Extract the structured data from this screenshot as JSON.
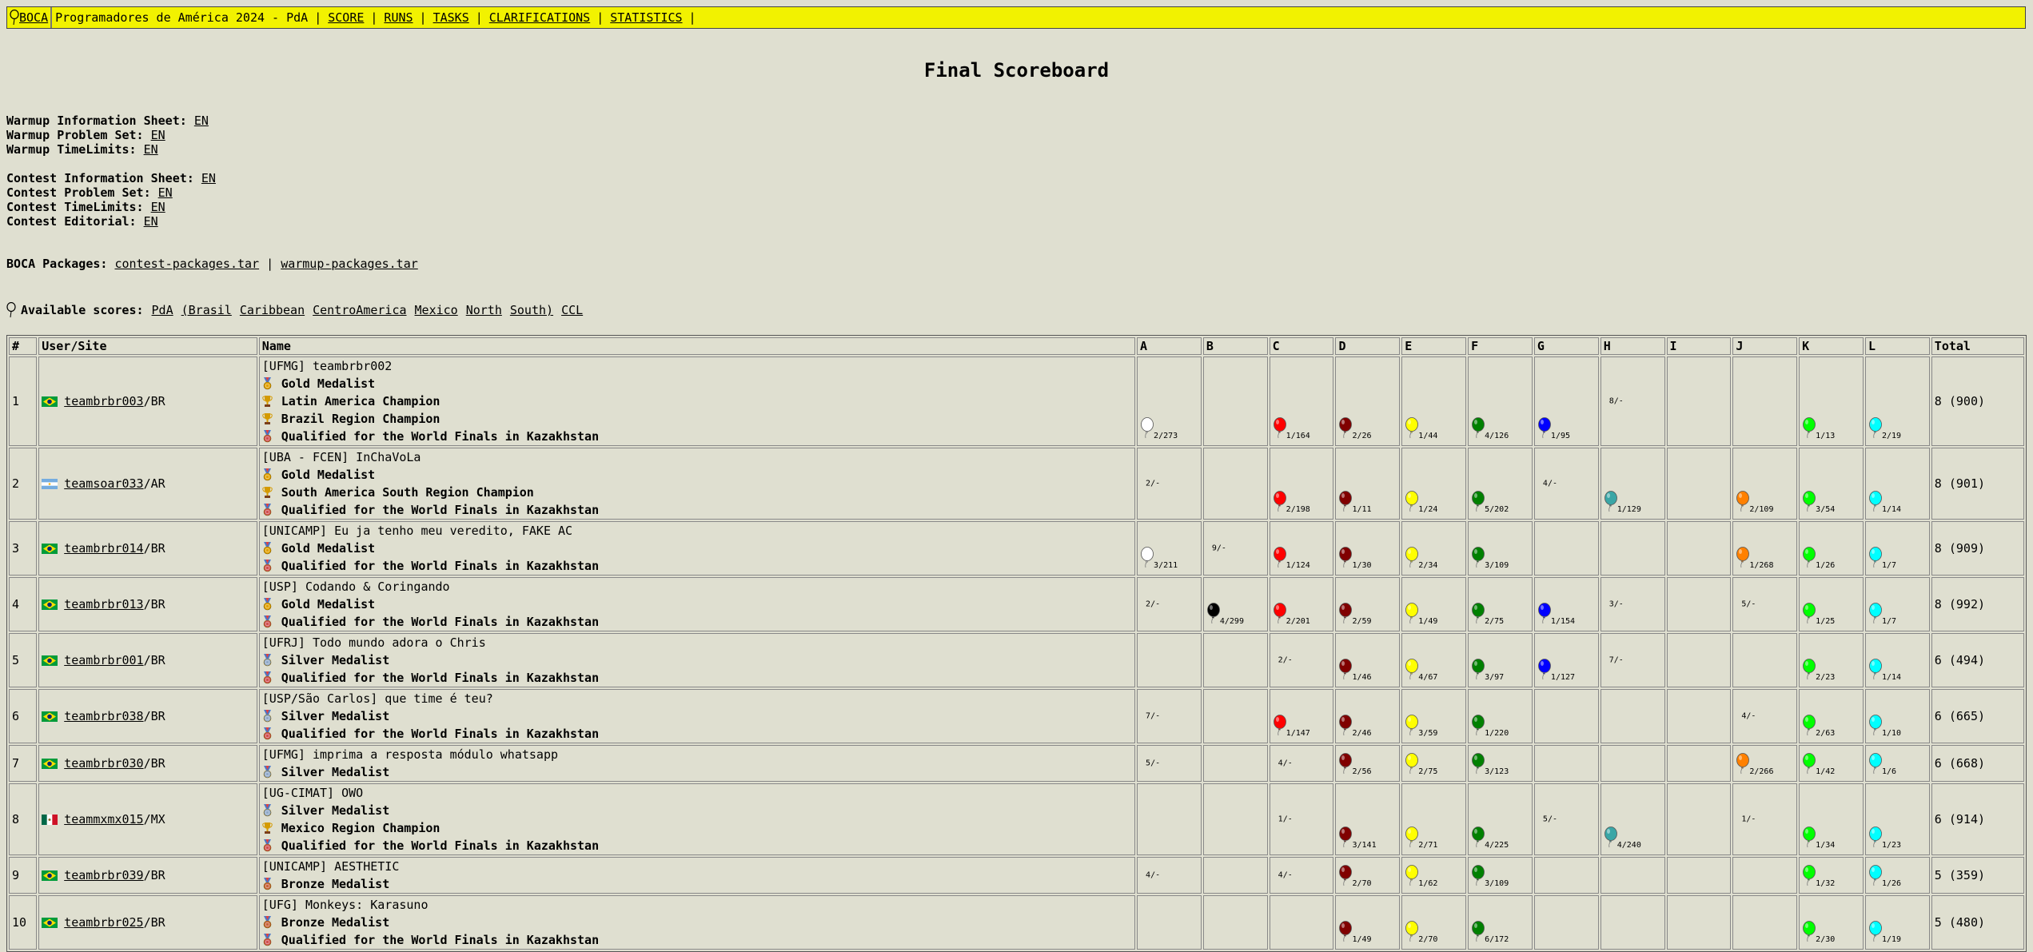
{
  "topbar": {
    "logo_label": "BOCA",
    "contest_title": "Programadores de América 2024 - PdA",
    "menu": [
      {
        "label": "SCORE",
        "name": "menu-score"
      },
      {
        "label": "RUNS",
        "name": "menu-runs"
      },
      {
        "label": "TASKS",
        "name": "menu-tasks"
      },
      {
        "label": "CLARIFICATIONS",
        "name": "menu-clarifications"
      },
      {
        "label": "STATISTICS",
        "name": "menu-statistics"
      }
    ],
    "separator": "|"
  },
  "page_title": "Final Scoreboard",
  "info_lines": [
    {
      "label": "Warmup Information Sheet:",
      "link": "EN"
    },
    {
      "label": "Warmup Problem Set:",
      "link": "EN"
    },
    {
      "label": "Warmup TimeLimits:",
      "link": "EN"
    },
    {
      "label": "Contest Information Sheet:",
      "link": "EN"
    },
    {
      "label": "Contest Problem Set:",
      "link": "EN"
    },
    {
      "label": "Contest TimeLimits:",
      "link": "EN"
    },
    {
      "label": "Contest Editorial:",
      "link": "EN"
    }
  ],
  "packages": {
    "label": "BOCA Packages:",
    "links": [
      "contest-packages.tar",
      "warmup-packages.tar"
    ],
    "separator": "|"
  },
  "scores": {
    "label": "Available scores:",
    "links": [
      "PdA",
      "(Brasil",
      "Caribbean",
      "CentroAmerica",
      "Mexico",
      "North",
      "South)",
      "CCL"
    ]
  },
  "table": {
    "headers": [
      "#",
      "User/Site",
      "Name",
      "A",
      "B",
      "C",
      "D",
      "E",
      "F",
      "G",
      "H",
      "I",
      "J",
      "K",
      "L",
      "Total"
    ],
    "problem_colors": {
      "A": "#ffffff",
      "B": "#000000",
      "C": "#ff0000",
      "D": "#800000",
      "E": "#ffff00",
      "F": "#008000",
      "G": "#0000ff",
      "H": "#3aa6a6",
      "I": "#cccccc",
      "J": "#ff8000",
      "K": "#00ff00",
      "L": "#00ffff"
    },
    "award_colors": {
      "gold": "#e2a100",
      "silver": "#8fa8c8",
      "bronze": "#c8643c",
      "trophy": "#d49a00",
      "finals": "#d05050"
    },
    "rows": [
      {
        "rank": "1",
        "flag": "BR",
        "user": "teambrbr003",
        "site": "/BR",
        "team": "[UFMG] teambrbr002",
        "awards": [
          {
            "type": "gold",
            "text": "Gold Medalist"
          },
          {
            "type": "trophy",
            "text": "Latin America Champion"
          },
          {
            "type": "trophy",
            "text": "Brazil Region Champion"
          },
          {
            "type": "finals",
            "text": "Qualified for the World Finals in Kazakhstan"
          }
        ],
        "cells": {
          "A": {
            "solved": true,
            "text": "2/273"
          },
          "B": null,
          "C": {
            "solved": true,
            "text": "1/164"
          },
          "D": {
            "solved": true,
            "text": "2/26"
          },
          "E": {
            "solved": true,
            "text": "1/44"
          },
          "F": {
            "solved": true,
            "text": "4/126"
          },
          "G": {
            "solved": true,
            "text": "1/95"
          },
          "H": {
            "solved": false,
            "text": "8/-"
          },
          "I": null,
          "J": null,
          "K": {
            "solved": true,
            "text": "1/13"
          },
          "L": {
            "solved": true,
            "text": "2/19"
          }
        },
        "total": "8 (900)"
      },
      {
        "rank": "2",
        "flag": "AR",
        "user": "teamsoar033",
        "site": "/AR",
        "team": "[UBA - FCEN] InChaVoLa",
        "awards": [
          {
            "type": "gold",
            "text": "Gold Medalist"
          },
          {
            "type": "trophy",
            "text": "South America South Region Champion"
          },
          {
            "type": "finals",
            "text": "Qualified for the World Finals in Kazakhstan"
          }
        ],
        "cells": {
          "A": {
            "solved": false,
            "text": "2/-"
          },
          "B": null,
          "C": {
            "solved": true,
            "text": "2/198"
          },
          "D": {
            "solved": true,
            "text": "1/11"
          },
          "E": {
            "solved": true,
            "text": "1/24"
          },
          "F": {
            "solved": true,
            "text": "5/202"
          },
          "G": {
            "solved": false,
            "text": "4/-"
          },
          "H": {
            "solved": true,
            "text": "1/129"
          },
          "I": null,
          "J": {
            "solved": true,
            "text": "2/109"
          },
          "K": {
            "solved": true,
            "text": "3/54"
          },
          "L": {
            "solved": true,
            "text": "1/14"
          }
        },
        "total": "8 (901)"
      },
      {
        "rank": "3",
        "flag": "BR",
        "user": "teambrbr014",
        "site": "/BR",
        "team": "[UNICAMP] Eu ja tenho meu veredito, FAKE AC",
        "awards": [
          {
            "type": "gold",
            "text": "Gold Medalist"
          },
          {
            "type": "finals",
            "text": "Qualified for the World Finals in Kazakhstan"
          }
        ],
        "cells": {
          "A": {
            "solved": true,
            "text": "3/211"
          },
          "B": {
            "solved": false,
            "text": "9/-"
          },
          "C": {
            "solved": true,
            "text": "1/124"
          },
          "D": {
            "solved": true,
            "text": "1/30"
          },
          "E": {
            "solved": true,
            "text": "2/34"
          },
          "F": {
            "solved": true,
            "text": "3/109"
          },
          "G": null,
          "H": null,
          "I": null,
          "J": {
            "solved": true,
            "text": "1/268"
          },
          "K": {
            "solved": true,
            "text": "1/26"
          },
          "L": {
            "solved": true,
            "text": "1/7"
          }
        },
        "total": "8 (909)"
      },
      {
        "rank": "4",
        "flag": "BR",
        "user": "teambrbr013",
        "site": "/BR",
        "team": "[USP] Codando & Coringando",
        "awards": [
          {
            "type": "gold",
            "text": "Gold Medalist"
          },
          {
            "type": "finals",
            "text": "Qualified for the World Finals in Kazakhstan"
          }
        ],
        "cells": {
          "A": {
            "solved": false,
            "text": "2/-"
          },
          "B": {
            "solved": true,
            "text": "4/299"
          },
          "C": {
            "solved": true,
            "text": "2/201"
          },
          "D": {
            "solved": true,
            "text": "2/59"
          },
          "E": {
            "solved": true,
            "text": "1/49"
          },
          "F": {
            "solved": true,
            "text": "2/75"
          },
          "G": {
            "solved": true,
            "text": "1/154"
          },
          "H": {
            "solved": false,
            "text": "3/-"
          },
          "I": null,
          "J": {
            "solved": false,
            "text": "5/-"
          },
          "K": {
            "solved": true,
            "text": "1/25"
          },
          "L": {
            "solved": true,
            "text": "1/7"
          }
        },
        "total": "8 (992)"
      },
      {
        "rank": "5",
        "flag": "BR",
        "user": "teambrbr001",
        "site": "/BR",
        "team": "[UFRJ] Todo mundo adora o Chris",
        "awards": [
          {
            "type": "silver",
            "text": "Silver Medalist"
          },
          {
            "type": "finals",
            "text": "Qualified for the World Finals in Kazakhstan"
          }
        ],
        "cells": {
          "A": null,
          "B": null,
          "C": {
            "solved": false,
            "text": "2/-"
          },
          "D": {
            "solved": true,
            "text": "1/46"
          },
          "E": {
            "solved": true,
            "text": "4/67"
          },
          "F": {
            "solved": true,
            "text": "3/97"
          },
          "G": {
            "solved": true,
            "text": "1/127"
          },
          "H": {
            "solved": false,
            "text": "7/-"
          },
          "I": null,
          "J": null,
          "K": {
            "solved": true,
            "text": "2/23"
          },
          "L": {
            "solved": true,
            "text": "1/14"
          }
        },
        "total": "6 (494)"
      },
      {
        "rank": "6",
        "flag": "BR",
        "user": "teambrbr038",
        "site": "/BR",
        "team": "[USP/São Carlos] que time é teu?",
        "awards": [
          {
            "type": "silver",
            "text": "Silver Medalist"
          },
          {
            "type": "finals",
            "text": "Qualified for the World Finals in Kazakhstan"
          }
        ],
        "cells": {
          "A": {
            "solved": false,
            "text": "7/-"
          },
          "B": null,
          "C": {
            "solved": true,
            "text": "1/147"
          },
          "D": {
            "solved": true,
            "text": "2/46"
          },
          "E": {
            "solved": true,
            "text": "3/59"
          },
          "F": {
            "solved": true,
            "text": "1/220"
          },
          "G": null,
          "H": null,
          "I": null,
          "J": {
            "solved": false,
            "text": "4/-"
          },
          "K": {
            "solved": true,
            "text": "2/63"
          },
          "L": {
            "solved": true,
            "text": "1/10"
          }
        },
        "total": "6 (665)"
      },
      {
        "rank": "7",
        "flag": "BR",
        "user": "teambrbr030",
        "site": "/BR",
        "team": "[UFMG] imprima a resposta módulo whatsapp",
        "awards": [
          {
            "type": "silver",
            "text": "Silver Medalist"
          }
        ],
        "cells": {
          "A": {
            "solved": false,
            "text": "5/-"
          },
          "B": null,
          "C": {
            "solved": false,
            "text": "4/-"
          },
          "D": {
            "solved": true,
            "text": "2/56"
          },
          "E": {
            "solved": true,
            "text": "2/75"
          },
          "F": {
            "solved": true,
            "text": "3/123"
          },
          "G": null,
          "H": null,
          "I": null,
          "J": {
            "solved": true,
            "text": "2/266"
          },
          "K": {
            "solved": true,
            "text": "1/42"
          },
          "L": {
            "solved": true,
            "text": "1/6"
          }
        },
        "total": "6 (668)"
      },
      {
        "rank": "8",
        "flag": "MX",
        "user": "teammxmx015",
        "site": "/MX",
        "team": "[UG-CIMAT] OWO",
        "awards": [
          {
            "type": "silver",
            "text": "Silver Medalist"
          },
          {
            "type": "trophy",
            "text": "Mexico Region Champion"
          },
          {
            "type": "finals",
            "text": "Qualified for the World Finals in Kazakhstan"
          }
        ],
        "cells": {
          "A": null,
          "B": null,
          "C": {
            "solved": false,
            "text": "1/-"
          },
          "D": {
            "solved": true,
            "text": "3/141"
          },
          "E": {
            "solved": true,
            "text": "2/71"
          },
          "F": {
            "solved": true,
            "text": "4/225"
          },
          "G": {
            "solved": false,
            "text": "5/-"
          },
          "H": {
            "solved": true,
            "text": "4/240"
          },
          "I": null,
          "J": {
            "solved": false,
            "text": "1/-"
          },
          "K": {
            "solved": true,
            "text": "1/34"
          },
          "L": {
            "solved": true,
            "text": "1/23"
          }
        },
        "total": "6 (914)"
      },
      {
        "rank": "9",
        "flag": "BR",
        "user": "teambrbr039",
        "site": "/BR",
        "team": "[UNICAMP] AESTHETIC",
        "awards": [
          {
            "type": "bronze",
            "text": "Bronze Medalist"
          }
        ],
        "cells": {
          "A": {
            "solved": false,
            "text": "4/-"
          },
          "B": null,
          "C": {
            "solved": false,
            "text": "4/-"
          },
          "D": {
            "solved": true,
            "text": "2/70"
          },
          "E": {
            "solved": true,
            "text": "1/62"
          },
          "F": {
            "solved": true,
            "text": "3/109"
          },
          "G": null,
          "H": null,
          "I": null,
          "J": null,
          "K": {
            "solved": true,
            "text": "1/32"
          },
          "L": {
            "solved": true,
            "text": "1/26"
          }
        },
        "total": "5 (359)"
      },
      {
        "rank": "10",
        "flag": "BR",
        "user": "teambrbr025",
        "site": "/BR",
        "team": "[UFG] Monkeys: Karasuno",
        "awards": [
          {
            "type": "bronze",
            "text": "Bronze Medalist"
          },
          {
            "type": "finals",
            "text": "Qualified for the World Finals in Kazakhstan"
          }
        ],
        "cells": {
          "A": null,
          "B": null,
          "C": null,
          "D": {
            "solved": true,
            "text": "1/49"
          },
          "E": {
            "solved": true,
            "text": "2/70"
          },
          "F": {
            "solved": true,
            "text": "6/172"
          },
          "G": null,
          "H": null,
          "I": null,
          "J": null,
          "K": {
            "solved": true,
            "text": "2/30"
          },
          "L": {
            "solved": true,
            "text": "1/19"
          }
        },
        "total": "5 (480)"
      }
    ]
  }
}
